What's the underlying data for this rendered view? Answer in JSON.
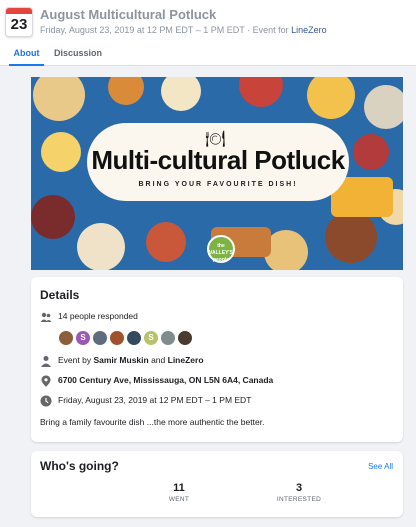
{
  "event": {
    "date_day": "23",
    "title": "August Multicultural Potluck",
    "subtitle_prefix": "Friday, August 23, 2019 at 12 PM EDT – 1 PM EDT · Event for ",
    "organizer_link": "LineZero"
  },
  "tabs": [
    {
      "label": "About",
      "active": true
    },
    {
      "label": "Discussion",
      "active": false
    }
  ],
  "banner": {
    "title": "Multi-cultural Potluck",
    "subtitle": "BRING YOUR FAVOURITE DISH!",
    "logo_text": "the VALLEY'S people",
    "icon": "plate-fork-knife-icon"
  },
  "details": {
    "heading": "Details",
    "responded": "14 people responded",
    "avatars": [
      {
        "letter": "",
        "color": "#8b5e3c"
      },
      {
        "letter": "S",
        "color": "#9b59b6"
      },
      {
        "letter": "",
        "color": "#5d6d7e"
      },
      {
        "letter": "",
        "color": "#a0522d"
      },
      {
        "letter": "",
        "color": "#34495e"
      },
      {
        "letter": "S",
        "color": "#b8c26a"
      },
      {
        "letter": "",
        "color": "#7f8c8d"
      },
      {
        "letter": "",
        "color": "#4a3b2f"
      }
    ],
    "event_by_prefix": "Event by ",
    "event_by_person": "Samir Muskin",
    "event_by_and": " and ",
    "event_by_org": "LineZero",
    "address": "6700 Century Ave, Mississauga, ON L5N 6A4, Canada",
    "datetime": "Friday, August 23, 2019 at 12 PM EDT – 1 PM EDT",
    "description": "Bring a family favourite dish ...the more authentic the better."
  },
  "going": {
    "heading": "Who's going?",
    "see_all": "See All",
    "went_count": "11",
    "went_label": "WENT",
    "interested_count": "3",
    "interested_label": "INTERESTED"
  },
  "colors": {
    "accent": "#1877f2",
    "calendar_red": "#e4453f",
    "banner_blue": "#2f6fb1"
  }
}
